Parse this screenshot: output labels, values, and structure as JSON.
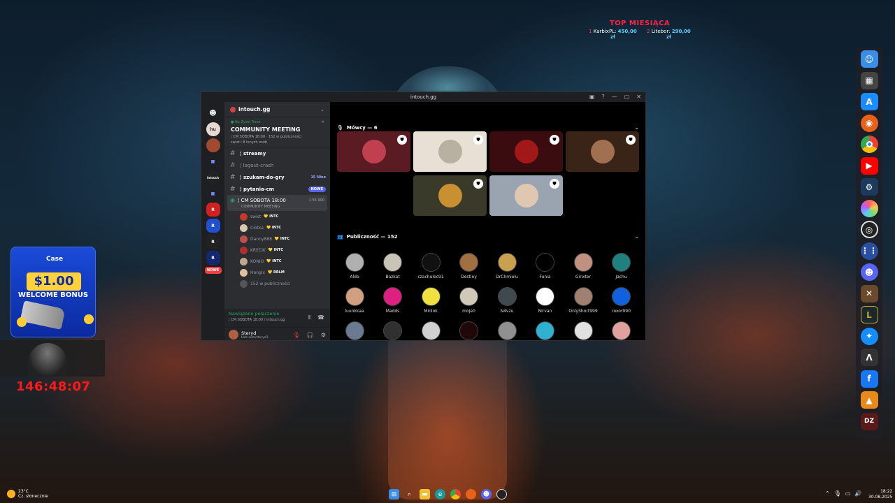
{
  "overlay": {
    "top_title": "TOP MIESIĄCA",
    "top_entries": [
      {
        "rank": "1",
        "name": "KarbixPL:",
        "amount": "450,00 zł"
      },
      {
        "rank": "2",
        "name": "Litebor:",
        "amount": "290,00 zł"
      }
    ],
    "timer": "146:48:07"
  },
  "casino_widget": {
    "brand": "Case",
    "price": "$1.00",
    "bonus": "WELCOME BONUS"
  },
  "window": {
    "title": "intouch.gg"
  },
  "server": {
    "name": "intouch.gg",
    "event": {
      "live_label": "Na Żywo Teraz",
      "title": "COMMUNITY MEETING",
      "info": "¦ CM SOBOTA 18:00 · 152 w publiczności",
      "info2": "swist i 8 innych osób"
    },
    "channels": [
      {
        "name": "¦ streamy",
        "bold": true
      },
      {
        "name": "¦ logout-crash",
        "bold": false
      },
      {
        "name": "¦ szukam-do-gry",
        "bold": true,
        "meta": "15 Nine"
      },
      {
        "name": "¦ pytania-cm",
        "bold": true,
        "badge": "NOWE"
      }
    ],
    "voice_channel": {
      "name": "¦ CM SOBOTA 18:00",
      "count": "1 56 900",
      "sub": "COMMUNITY MEETING"
    },
    "members": [
      {
        "name": "swist",
        "tag": "INTC",
        "color": "#c0392b"
      },
      {
        "name": "Clotka",
        "tag": "INTC",
        "color": "#d8c8b0"
      },
      {
        "name": "Danny888",
        "tag": "INTC",
        "color": "#c05050"
      },
      {
        "name": "KRECIK",
        "tag": "INTC",
        "color": "#b03030"
      },
      {
        "name": "KONIO",
        "tag": "INTC",
        "color": "#c0a890"
      },
      {
        "name": "Hangix",
        "tag": "RRLM",
        "color": "#e0c0a0"
      },
      {
        "name": "152 w publiczności",
        "tag": "",
        "color": "#555"
      }
    ],
    "guild_new": "NOWE"
  },
  "connection": {
    "status": "Nawiązano połączenie",
    "detail": "¦ CM SOBOTA 18:00 / intouch.gg"
  },
  "user": {
    "name": "Steryd",
    "status": "kick.com/steryd3"
  },
  "stage": {
    "speakers_label": "Mówcy — 6",
    "audience_label": "Publiczność — 152",
    "speakers": [
      {
        "bg": "#5a1c22",
        "ring": "#c04050"
      },
      {
        "bg": "#e8e0d4",
        "ring": "#b8b0a0"
      },
      {
        "bg": "#3a0c10",
        "ring": "#a01818"
      },
      {
        "bg": "#3a2418",
        "ring": "#a07050"
      },
      {
        "bg": "#3a3a2a",
        "ring": "#c89030"
      },
      {
        "bg": "#9aa4b0",
        "ring": "#e0c8b0"
      }
    ],
    "audience": [
      {
        "name": "Aldo",
        "color": "#b0b0b0"
      },
      {
        "name": "Bazkat",
        "color": "#c8c4b8"
      },
      {
        "name": "czachulec91",
        "color": "#111111"
      },
      {
        "name": "Destiny",
        "color": "#a07040"
      },
      {
        "name": "DrChmielu",
        "color": "#c8a050"
      },
      {
        "name": "Funia",
        "color": "#000000"
      },
      {
        "name": "Ginxter",
        "color": "#c09080"
      },
      {
        "name": "Jachu",
        "color": "#208080"
      },
      {
        "name": "luunkkaa",
        "color": "#d0a080"
      },
      {
        "name": "Madds",
        "color": "#e02080"
      },
      {
        "name": "Minlok",
        "color": "#f0e040"
      },
      {
        "name": "moje0",
        "color": "#d0c8b8"
      },
      {
        "name": "N4vzu",
        "color": "#404850"
      },
      {
        "name": "Nirvan",
        "color": "#ffffff"
      },
      {
        "name": "OnlyShort999",
        "color": "#a08070"
      },
      {
        "name": "roxor990",
        "color": "#1060e0"
      }
    ],
    "audience_row3": [
      "#6a7a90",
      "#303030",
      "#d0d0d0",
      "#200808",
      "#909090",
      "#30b0d0",
      "#e0e0e0",
      "#e0a0a0"
    ]
  },
  "taskbar": {
    "temp": "23°C",
    "weather": "Cz. słonecznie",
    "time": "18:22",
    "date": "30.08.2025"
  }
}
